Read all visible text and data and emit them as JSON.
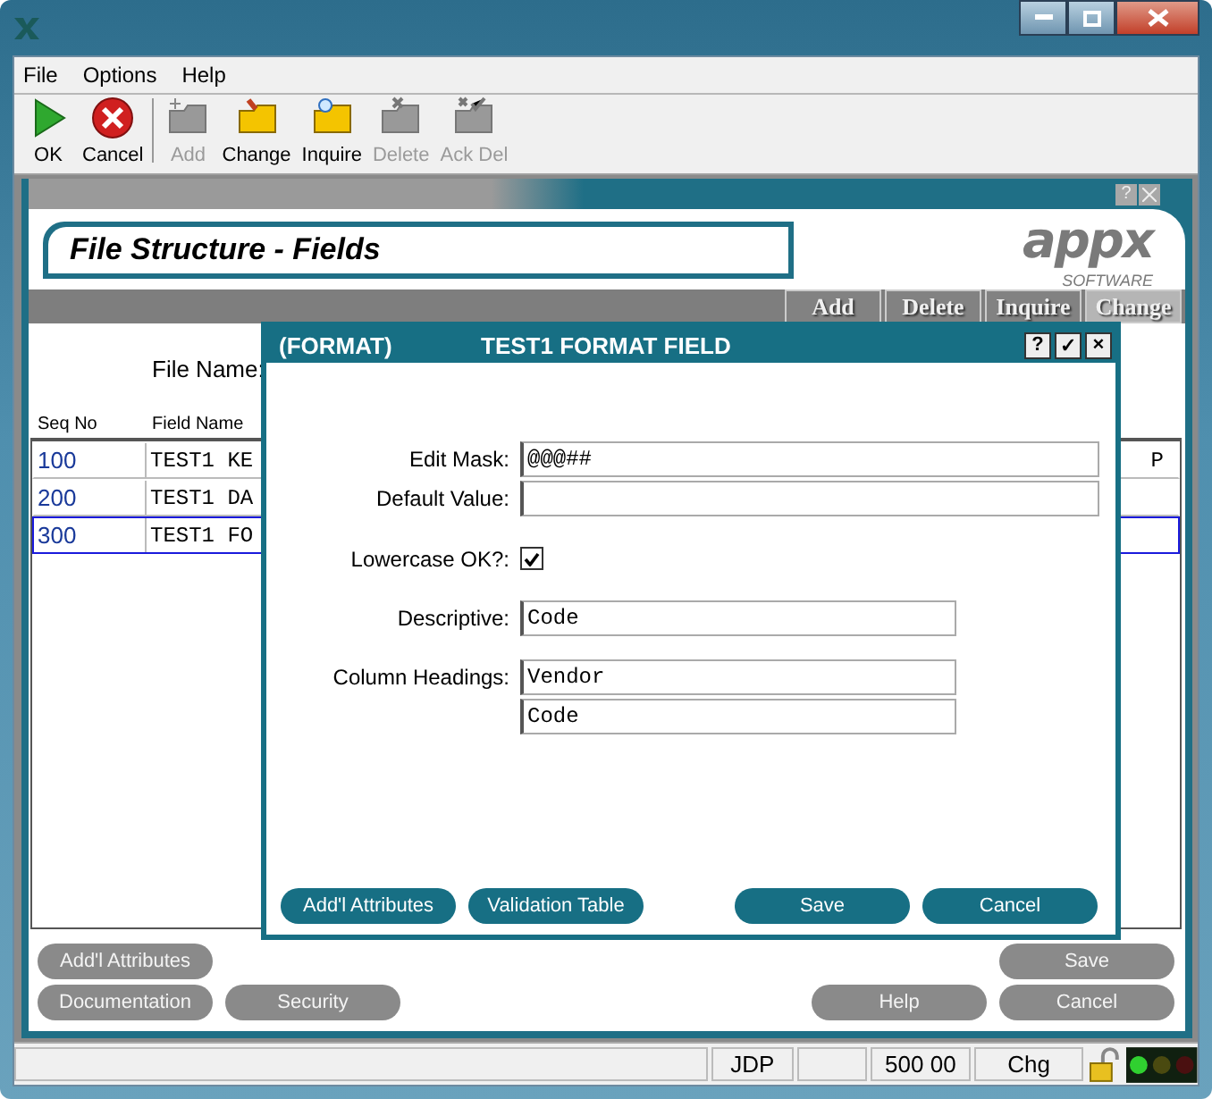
{
  "menu": [
    "File",
    "Options",
    "Help"
  ],
  "toolbar": [
    {
      "label": "OK",
      "disabled": false
    },
    {
      "label": "Cancel",
      "disabled": false
    },
    {
      "label": "Add",
      "disabled": true
    },
    {
      "label": "Change",
      "disabled": false
    },
    {
      "label": "Inquire",
      "disabled": false
    },
    {
      "label": "Delete",
      "disabled": true
    },
    {
      "label": "Ack Del",
      "disabled": true
    }
  ],
  "frame_buttons": [
    "?"
  ],
  "banner": {
    "title": "File Structure - Fields",
    "logo": "appx",
    "logo_sub": "SOFTWARE"
  },
  "action_tabs": [
    {
      "label": "Add",
      "selected": false
    },
    {
      "label": "Delete",
      "selected": false
    },
    {
      "label": "Inquire",
      "selected": false
    },
    {
      "label": "Change",
      "selected": true
    }
  ],
  "file_name_label": "File Name:",
  "table": {
    "columns": [
      "Seq No",
      "Field Name"
    ],
    "rows": [
      {
        "seq": "100",
        "name": "TEST1 KE",
        "column_3": "P",
        "selected": false
      },
      {
        "seq": "200",
        "name": "TEST1 DA",
        "selected": false
      },
      {
        "seq": "300",
        "name": "TEST1 FO",
        "selected": true
      }
    ]
  },
  "bottom_buttons": [
    {
      "left": [
        "Add'l Attributes"
      ],
      "right": [
        "Save"
      ]
    },
    {
      "left": [
        "Documentation",
        "Security"
      ],
      "right": [
        "Help",
        "Cancel"
      ]
    }
  ],
  "dialog": {
    "tag": "(FORMAT)",
    "title": "TEST1 FORMAT FIELD",
    "title_buttons": [
      "?",
      "✓",
      "×"
    ],
    "fields": [
      {
        "kind": "text",
        "label": "Edit Mask:",
        "value": "@@@##"
      },
      {
        "kind": "text",
        "label": "Default Value:"
      },
      {
        "kind": "check",
        "label": "Lowercase OK?:",
        "checked": true
      },
      {
        "kind": "text",
        "label": "Descriptive:",
        "value": "Code"
      },
      {
        "kind": "text",
        "label": "Column Headings:",
        "value": "Vendor"
      },
      {
        "kind": "text",
        "value": "Code"
      }
    ],
    "buttons_left": [
      "Add'l Attributes",
      "Validation Table"
    ],
    "buttons_right": [
      "Save",
      "Cancel"
    ]
  },
  "status_bar": [
    "JDP",
    "500 00",
    "Chg"
  ]
}
